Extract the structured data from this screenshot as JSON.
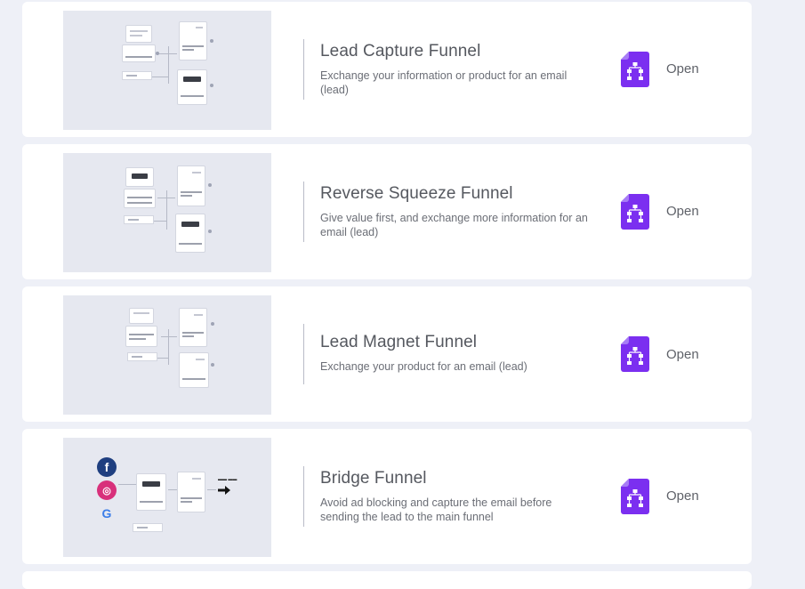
{
  "funnels": [
    {
      "title": "Lead Capture Funnel",
      "description": "Exchange your information or product for an email (lead)",
      "open_label": "Open",
      "icon": "funnel-document-icon",
      "thumbnail": "lead-capture-diagram"
    },
    {
      "title": "Reverse Squeeze Funnel",
      "description": "Give value first, and exchange more information for an email (lead)",
      "open_label": "Open",
      "icon": "funnel-document-icon",
      "thumbnail": "reverse-squeeze-diagram"
    },
    {
      "title": "Lead Magnet Funnel",
      "description": "Exchange your product for an email (lead)",
      "open_label": "Open",
      "icon": "funnel-document-icon",
      "thumbnail": "lead-magnet-diagram"
    },
    {
      "title": "Bridge Funnel",
      "description": "Avoid ad blocking and capture the email before sending the lead to the main funnel",
      "open_label": "Open",
      "icon": "funnel-document-icon",
      "thumbnail": "bridge-diagram"
    }
  ],
  "colors": {
    "page_background": "#eef0f7",
    "card_background": "#ffffff",
    "icon_purple": "#7b2ff0",
    "thumbnail_background": "#e6e8f0"
  }
}
